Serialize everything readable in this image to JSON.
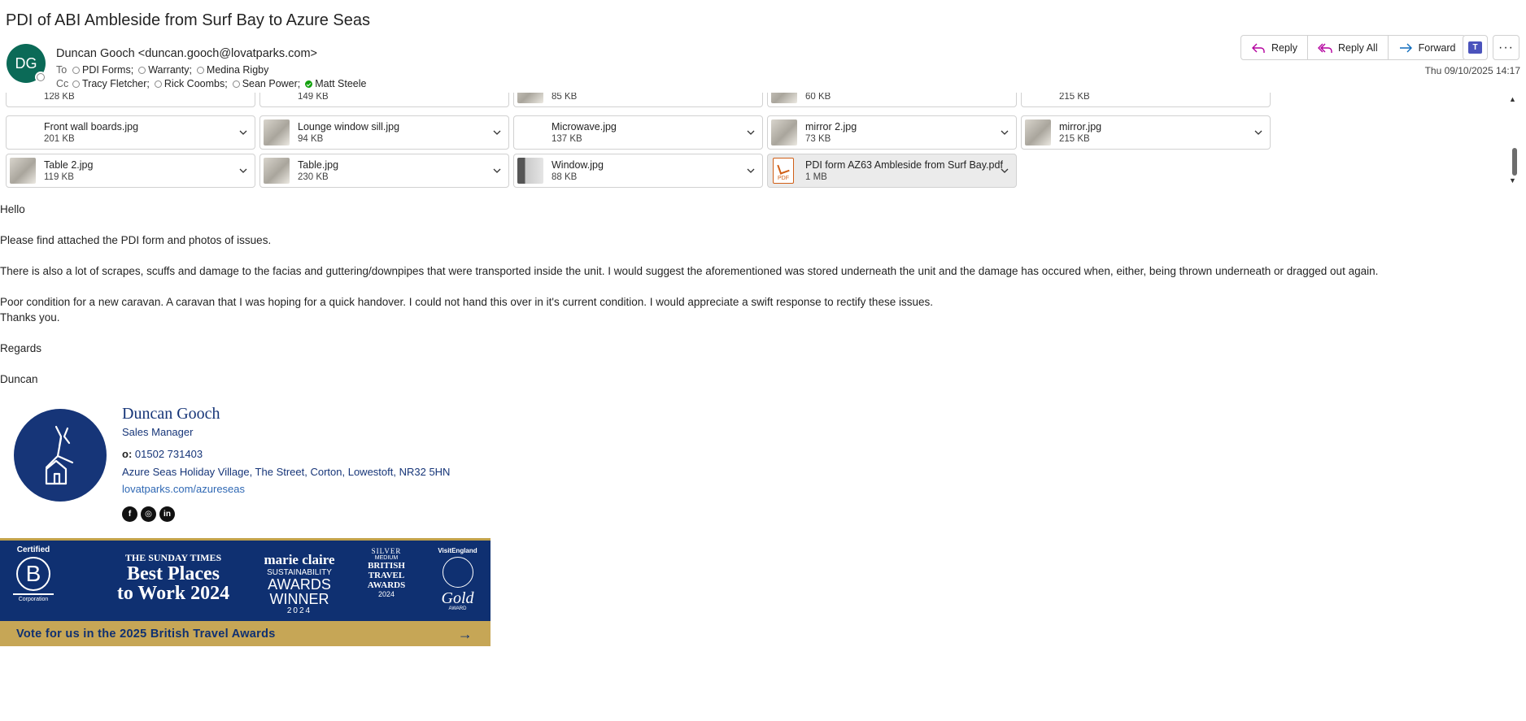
{
  "subject": "PDI of ABI Ambleside from Surf Bay to Azure Seas",
  "sender": {
    "initials": "DG",
    "display": "Duncan Gooch <duncan.gooch@lovatparks.com>"
  },
  "to_label": "To",
  "cc_label": "Cc",
  "to": [
    "PDI Forms;",
    "Warranty;",
    "Medina Rigby"
  ],
  "cc": [
    "Tracy Fletcher;",
    "Rick Coombs;",
    "Sean Power;",
    "Matt Steele"
  ],
  "actions": {
    "reply": "Reply",
    "reply_all": "Reply All",
    "forward": "Forward",
    "teams_icon": "teams-icon",
    "more_icon": "more-icon"
  },
  "date": "Thu 09/10/2025 14:17",
  "attachments_partial": [
    {
      "size": "128 KB"
    },
    {
      "size": "149 KB"
    },
    {
      "size": "85 KB"
    },
    {
      "size": "60 KB"
    },
    {
      "size": "215 KB"
    }
  ],
  "attachments": [
    {
      "name": "Front wall boards.jpg",
      "size": "201 KB",
      "thumb": false
    },
    {
      "name": "Lounge window sill.jpg",
      "size": "94 KB",
      "thumb": true
    },
    {
      "name": "Microwave.jpg",
      "size": "137 KB",
      "thumb": false
    },
    {
      "name": "mirror 2.jpg",
      "size": "73 KB",
      "thumb": true
    },
    {
      "name": "mirror.jpg",
      "size": "215 KB",
      "thumb": true
    },
    {
      "name": "Table 2.jpg",
      "size": "119 KB",
      "thumb": true
    },
    {
      "name": "Table.jpg",
      "size": "230 KB",
      "thumb": true
    },
    {
      "name": "Window.jpg",
      "size": "88 KB",
      "thumb": true
    },
    {
      "name": "PDI form AZ63 Ambleside from Surf Bay.pdf",
      "size": "1 MB",
      "pdf": true
    }
  ],
  "body": {
    "greeting": "Hello",
    "p1": "Please find attached the PDI form and photos of issues.",
    "p2": "There is also a lot of scrapes, scuffs and damage to the facias and guttering/downpipes that were transported inside the unit. I would suggest the aforementioned was stored underneath the unit and the damage has occured when, either, being thrown underneath or dragged out again.",
    "p3": "Poor condition for a new caravan. A caravan that I was hoping for a quick handover. I could not hand this over in it's current condition. I would appreciate a swift response to rectify these issues.",
    "p4": "Thanks you.",
    "regards": "Regards",
    "signoff": "Duncan"
  },
  "signature": {
    "name": "Duncan Gooch",
    "title": "Sales Manager",
    "phone_label": "o:",
    "phone": "01502 731403",
    "address": "Azure Seas Holiday Village, The Street, Corton, Lowestoft, NR32 5HN",
    "website": "lovatparks.com/azureseas"
  },
  "banner": {
    "b_corp_top": "Certified",
    "b_corp_bottom": "Corporation",
    "sunday_times": "THE SUNDAY TIMES",
    "best_places": "Best Places",
    "to_work": "to Work 2024",
    "marie_claire": "marie claire",
    "sustainability": "SUSTAINABILITY",
    "awards": "AWARDS",
    "winner": "WINNER",
    "year": "2024",
    "silver": "SILVER",
    "medium": "MEDIUM",
    "british": "BRITISH",
    "travel": "TRAVEL",
    "awards2": "AWARDS",
    "year2": "2024",
    "visit_england": "VisitEngland",
    "gold": "Gold",
    "gold_award": "AWARD",
    "vote": "Vote for us in the 2025 British Travel Awards"
  },
  "colors": {
    "avatar": "#0b6a57",
    "brand_navy": "#163578",
    "banner_gold": "#c6a656",
    "link": "#2f68b4"
  }
}
